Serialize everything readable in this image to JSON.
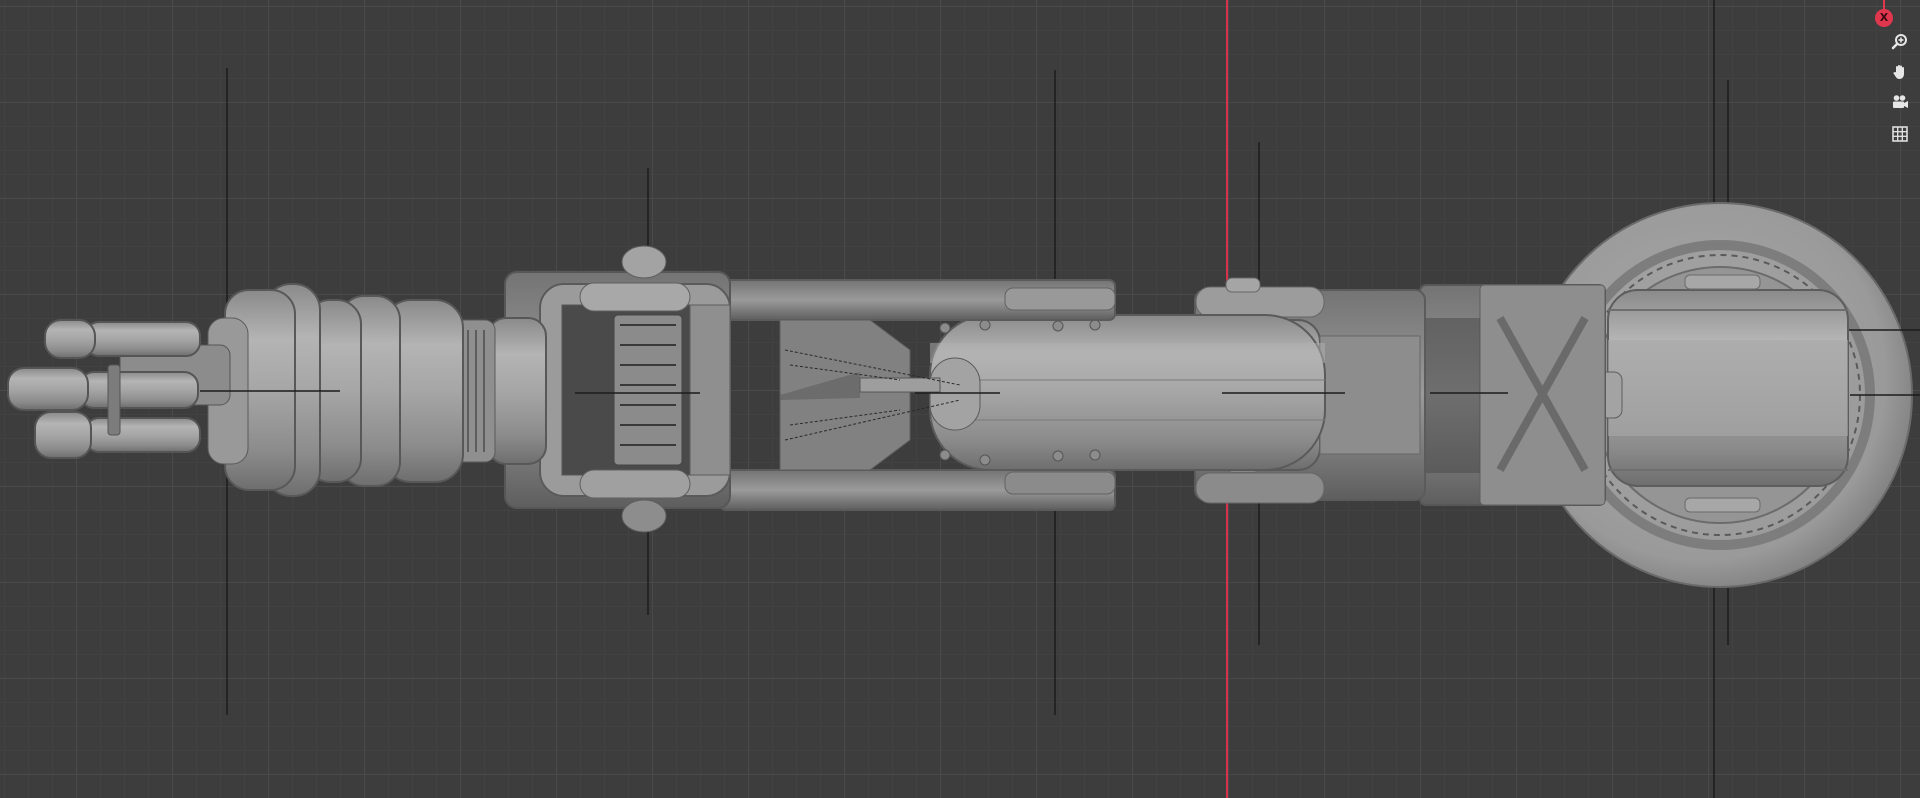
{
  "viewport": {
    "background_color": "#3d3d3d",
    "grid_color_major": "#4a4a4a",
    "grid_color_minor": "#424242",
    "x_axis_color": "#d8324b",
    "model_color": "#9d9d9d"
  },
  "navigation_gizmo": {
    "axis_label": "X",
    "axis_color": "#e0374f",
    "buttons": [
      {
        "icon": "zoom-icon"
      },
      {
        "icon": "pan-hand-icon"
      },
      {
        "icon": "camera-view-icon"
      },
      {
        "icon": "ortho-grid-icon"
      }
    ]
  }
}
